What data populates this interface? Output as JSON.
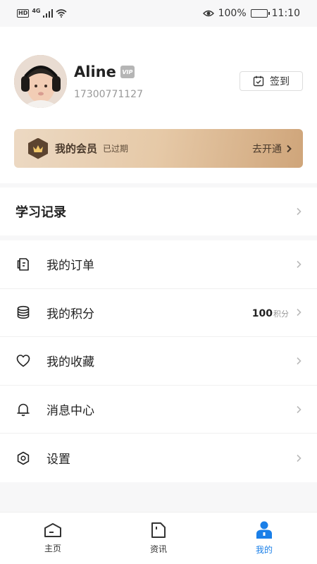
{
  "status_bar": {
    "network_badge": "HD",
    "signal_label": "4G",
    "battery": "100%",
    "time": "11:10"
  },
  "profile": {
    "name": "Aline",
    "vip_label": "VIP",
    "phone": "17300771127",
    "signin_label": "签到"
  },
  "membership": {
    "title": "我的会员",
    "status": "已过期",
    "action": "去开通"
  },
  "record": {
    "title": "学习记录"
  },
  "menu": {
    "items": [
      {
        "label": "我的订单",
        "icon": "order-icon"
      },
      {
        "label": "我的积分",
        "icon": "coins-icon"
      },
      {
        "label": "我的收藏",
        "icon": "heart-icon"
      },
      {
        "label": "消息中心",
        "icon": "bell-icon"
      },
      {
        "label": "设置",
        "icon": "gear-icon"
      }
    ],
    "points_value": "100",
    "points_unit": "积分"
  },
  "tabs": [
    {
      "label": "主页",
      "icon": "home-icon"
    },
    {
      "label": "资讯",
      "icon": "news-icon"
    },
    {
      "label": "我的",
      "icon": "user-icon"
    }
  ],
  "colors": {
    "accent": "#1a7fe8",
    "member_dark": "#4a3a2c",
    "member_gold": "#cfa57a"
  }
}
